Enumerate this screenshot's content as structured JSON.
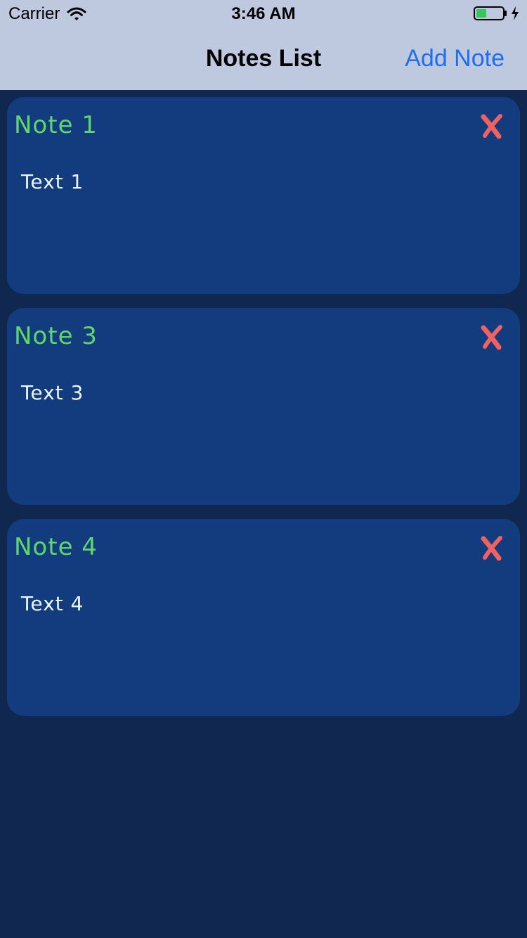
{
  "status_bar": {
    "carrier": "Carrier",
    "time": "3:46 AM",
    "battery_color": "#34c759"
  },
  "nav": {
    "title": "Notes List",
    "add_label": "Add Note"
  },
  "notes": [
    {
      "title": "Note 1",
      "text": "Text 1",
      "delete_icon": "close-icon"
    },
    {
      "title": "Note 3",
      "text": "Text 3",
      "delete_icon": "close-icon"
    },
    {
      "title": "Note 4",
      "text": "Text 4",
      "delete_icon": "close-icon"
    }
  ],
  "colors": {
    "background": "#10284f",
    "card": "#133c7e",
    "title": "#5fd86a",
    "text": "#eaf6ff",
    "delete": "#f06262",
    "accent": "#1f6ef0",
    "bar": "#bec8de"
  }
}
